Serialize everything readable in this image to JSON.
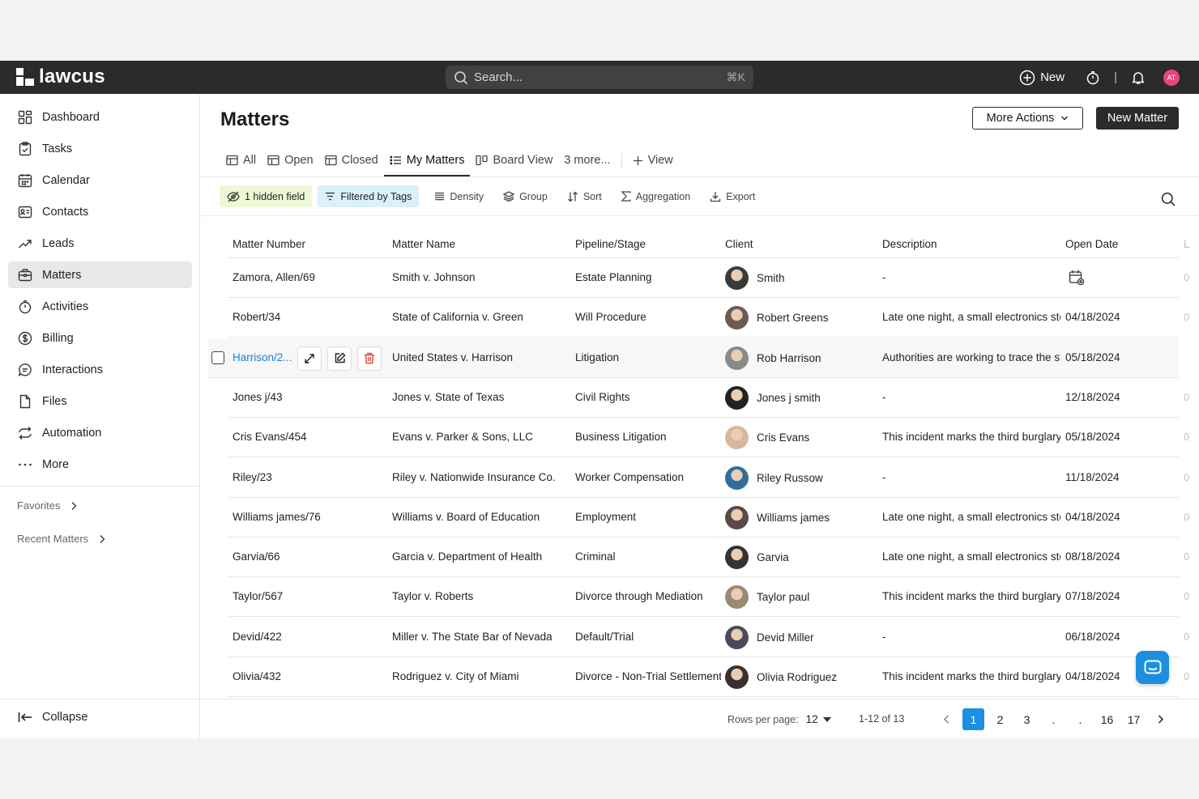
{
  "brand": {
    "name": "lawcus"
  },
  "header": {
    "search_placeholder": "Search...",
    "search_shortcut": "⌘K",
    "new_label": "New",
    "separator": "|",
    "avatar_initials": "AT",
    "avatar_color": "#e8457f"
  },
  "sidebar": {
    "items": [
      {
        "label": "Dashboard"
      },
      {
        "label": "Tasks"
      },
      {
        "label": "Calendar"
      },
      {
        "label": "Contacts"
      },
      {
        "label": "Leads"
      },
      {
        "label": "Matters"
      },
      {
        "label": "Activities"
      },
      {
        "label": "Billing"
      },
      {
        "label": "Interactions"
      },
      {
        "label": "Files"
      },
      {
        "label": "Automation"
      },
      {
        "label": "More"
      }
    ],
    "active": "Matters",
    "favorites": "Favorites",
    "recent": "Recent Matters",
    "collapse": "Collapse"
  },
  "main": {
    "title": "Matters",
    "more_actions": "More Actions",
    "new_matter": "New Matter",
    "tabs": [
      {
        "label": "All"
      },
      {
        "label": "Open"
      },
      {
        "label": "Closed"
      },
      {
        "label": "My Matters"
      },
      {
        "label": "Board View"
      },
      {
        "label": "3 more..."
      }
    ],
    "add_view": "View",
    "toolbar": {
      "hidden_field": "1 hidden field",
      "filtered": "Filtered by Tags",
      "density": "Density",
      "group": "Group",
      "sort": "Sort",
      "aggregation": "Aggregation",
      "export": "Export"
    }
  },
  "table": {
    "columns": [
      "Matter Number",
      "Matter Name",
      "Pipeline/Stage",
      "Client",
      "Description",
      "Open Date",
      "L"
    ],
    "rows": [
      {
        "number": "Zamora, Allen/69",
        "name": "Smith v. Johnson",
        "stage": "Estate Planning",
        "client": "Smith",
        "description": "-",
        "open_date": "",
        "last": "0"
      },
      {
        "number": "Robert/34",
        "name": "State of California v. Green",
        "stage": "Will Procedure",
        "client": "Robert Greens",
        "description": "Late one night, a small electronics store",
        "open_date": "04/18/2024",
        "last": "0"
      },
      {
        "number": "Harrison/2...",
        "name": "United States v. Harrison",
        "stage": "Litigation",
        "client": "Rob Harrison",
        "description": "Authorities are working to trace the stolen",
        "open_date": "05/18/2024",
        "last": ""
      },
      {
        "number": "Jones j/43",
        "name": "Jones v. State of Texas",
        "stage": "Civil Rights",
        "client": "Jones j smith",
        "description": "-",
        "open_date": "12/18/2024",
        "last": "0"
      },
      {
        "number": "Cris Evans/454",
        "name": "Evans v. Parker & Sons, LLC",
        "stage": "Business Litigation",
        "client": "Cris Evans",
        "description": "This incident marks the third burglary",
        "open_date": "05/18/2024",
        "last": "0"
      },
      {
        "number": "Riley/23",
        "name": "Riley v. Nationwide Insurance Co.",
        "stage": "Worker Compensation",
        "client": "Riley Russow",
        "description": "-",
        "open_date": "11/18/2024",
        "last": "0"
      },
      {
        "number": "Williams james/76",
        "name": "Williams v. Board of Education",
        "stage": "Employment",
        "client": "Williams james",
        "description": "Late one night, a small electronics store",
        "open_date": "04/18/2024",
        "last": "0"
      },
      {
        "number": "Garvia/66",
        "name": "Garcia v. Department of Health",
        "stage": "Criminal",
        "client": "Garvia",
        "description": "Late one night, a small electronics store",
        "open_date": "08/18/2024",
        "last": "0"
      },
      {
        "number": "Taylor/567",
        "name": "Taylor v. Roberts",
        "stage": "Divorce through Mediation",
        "client": "Taylor paul",
        "description": "This incident marks the third burglary",
        "open_date": "07/18/2024",
        "last": "0"
      },
      {
        "number": "Devid/422",
        "name": "Miller v. The State Bar of Nevada",
        "stage": "Default/Trial",
        "client": "Devid Miller",
        "description": "-",
        "open_date": "06/18/2024",
        "last": "0"
      },
      {
        "number": "Olivia/432",
        "name": "Rodriguez v. City of Miami",
        "stage": "Divorce - Non-Trial Settlement",
        "client": "Olivia Rodriguez",
        "description": "This incident marks the third burglary",
        "open_date": "04/18/2024",
        "last": "0"
      }
    ]
  },
  "footer": {
    "rows_per_page_label": "Rows per page:",
    "rows_per_page": "12",
    "range": "1-12 of 13",
    "pages": [
      "1",
      "2",
      "3",
      ".",
      ".",
      "16",
      "17"
    ],
    "active_page": "1"
  },
  "colors": {
    "topbar": "#2b2b2b",
    "accent": "#1d8fe0",
    "link": "#1f7ed4",
    "chip_green": "#eef8d6",
    "chip_blue": "#daf0fb"
  }
}
